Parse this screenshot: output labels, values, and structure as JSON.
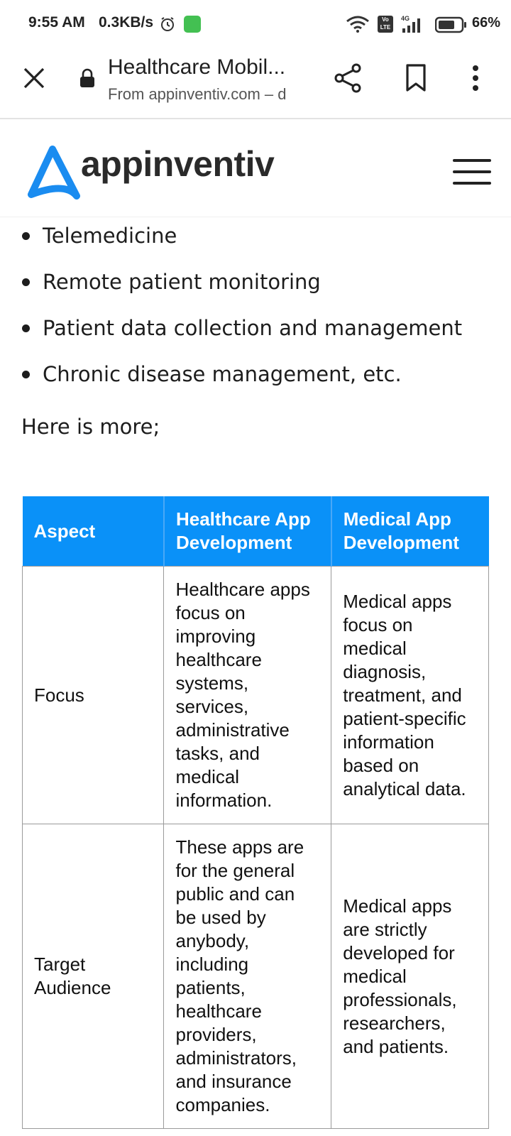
{
  "status_bar": {
    "time": "9:55 AM",
    "net_speed": "0.3KB/s",
    "network_type": "4G",
    "volte": "Vo LTE",
    "battery_percent": "66%"
  },
  "toolbar": {
    "title": "Healthcare Mobil...",
    "url": "From appinventiv.com – d"
  },
  "site": {
    "logo_text": "appinventiv",
    "accent_color": "#1a8cf0"
  },
  "article": {
    "bullets": [
      "Telemedicine",
      "Remote patient monitoring",
      "Patient data collection and management",
      "Chronic disease management, etc."
    ],
    "intro": "Here is more;"
  },
  "table": {
    "headers": [
      "Aspect",
      "Healthcare App Development",
      "Medical App Development"
    ],
    "rows": [
      [
        "Focus",
        "Healthcare apps focus on improving healthcare systems, services, administrative tasks, and medical information.",
        "Medical apps focus on medical diagnosis, treatment, and patient-specific information based on analytical data."
      ],
      [
        "Target Audience",
        "These apps are for the general public and can be used by anybody, including patients, healthcare providers, administrators, and insurance companies.",
        "Medical apps are strictly developed for medical professionals, researchers, and patients."
      ]
    ],
    "header_color": "#0a91f8"
  }
}
